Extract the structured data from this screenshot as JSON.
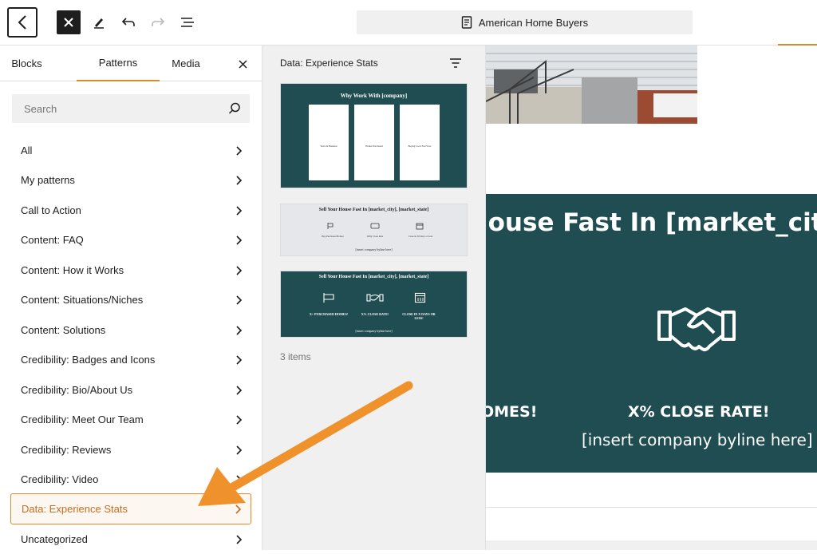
{
  "toolbar": {
    "document_title": "American Home Buyers"
  },
  "inserter": {
    "tabs": [
      "Blocks",
      "Patterns",
      "Media"
    ],
    "active_tab": "Patterns",
    "search_placeholder": "Search",
    "categories": [
      "All",
      "My patterns",
      "Call to Action",
      "Content: FAQ",
      "Content: How it Works",
      "Content: Situations/Niches",
      "Content: Solutions",
      "Credibility: Badges and Icons",
      "Credibility: Bio/About Us",
      "Credibility: Meet Our Team",
      "Credibility: Reviews",
      "Credibility: Video",
      "Data: Experience Stats",
      "Uncategorized"
    ],
    "active_category": "Data: Experience Stats"
  },
  "patterns": {
    "title": "Data: Experience Stats",
    "count_label": "3 items",
    "previews": [
      {
        "heading": "Why Work With [company]",
        "cards": [
          "Years In Business",
          "Homes Purchased",
          "Buying Local Fast Wow"
        ]
      },
      {
        "heading": "Sell Your House Fast In [market_city], [market_state]",
        "stats": [
          "Buy Purchased Homes",
          "Willy Close Rate",
          "Close In 30 Days or Less"
        ],
        "byline": "[insert company byline here]"
      },
      {
        "heading": "Sell Your House Fast In [market_city], [market_state]",
        "stats": [
          "X+ PURCHASED HOMES!",
          "X% CLOSE RATE!",
          "CLOSE IN X DAYS OR LESS!"
        ],
        "byline": "[insert company byline here]"
      }
    ]
  },
  "canvas": {
    "heading_fragment": "louse Fast In [market_city",
    "stat_left": "OMES!",
    "stat_center": "X% CLOSE RATE!",
    "byline": "[insert company byline here]"
  },
  "colors": {
    "accent_orange": "#d98c2b",
    "teal": "#1f4d52",
    "arrow": "#f0922b"
  }
}
